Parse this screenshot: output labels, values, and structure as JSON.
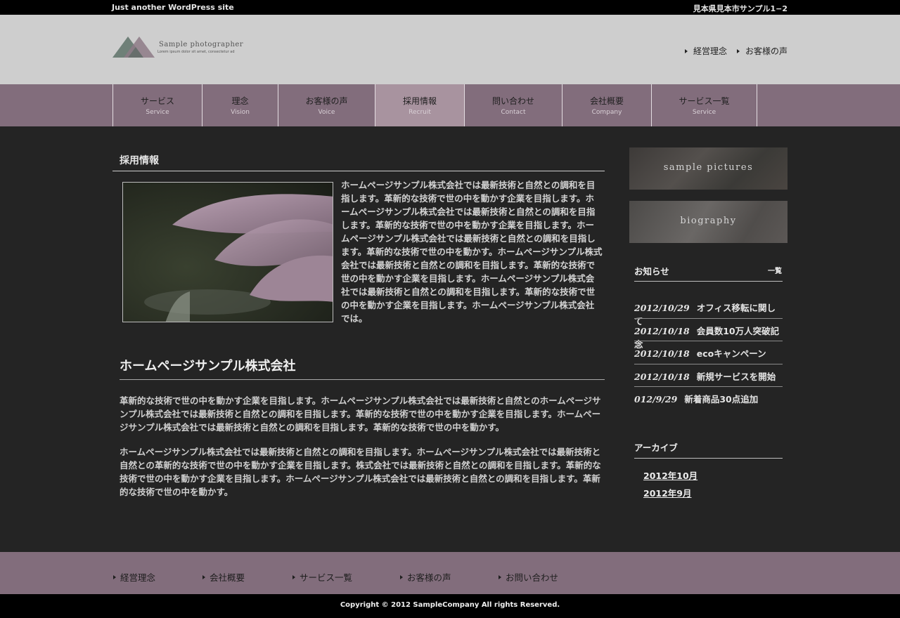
{
  "topbar": {
    "tagline": "Just another WordPress site",
    "address": "見本県見本市サンプル1−2"
  },
  "logo": {
    "name": "Sample photographer",
    "subtitle": "Lorem ipsum dolor sit amet, consectetur ad"
  },
  "header_links": [
    "経営理念",
    "お客様の声"
  ],
  "nav": [
    {
      "jp": "サービス",
      "en": "Service"
    },
    {
      "jp": "理念",
      "en": "Vision"
    },
    {
      "jp": "お客様の声",
      "en": "Voice"
    },
    {
      "jp": "採用情報",
      "en": "Recruit",
      "active": true
    },
    {
      "jp": "問い合わせ",
      "en": "Contact"
    },
    {
      "jp": "会社概要",
      "en": "Company"
    },
    {
      "jp": "サービス一覧",
      "en": "Service"
    }
  ],
  "main": {
    "section_title": "採用情報",
    "intro_text": "ホームページサンプル株式会社では最新技術と自然との調和を目指します。革新的な技術で世の中を動かす企業を目指します。ホームページサンプル株式会社では最新技術と自然との調和を目指します。革新的な技術で世の中を動かす企業を目指します。ホームページサンプル株式会社では最新技術と自然との調和を目指します。革新的な技術で世の中を動かす。ホームページサンプル株式会社では最新技術と自然との調和を目指します。革新的な技術で世の中を動かす企業を目指します。ホームページサンプル株式会社では最新技術と自然との調和を目指します。革新的な技術で世の中を動かす企業を目指します。ホームページサンプル株式会社では。",
    "company_title": "ホームページサンプル株式会社",
    "paragraph1": "革新的な技術で世の中を動かす企業を目指します。ホームページサンプル株式会社では最新技術と自然とのホームページサンプル株式会社では最新技術と自然との調和を目指します。革新的な技術で世の中を動かす企業を目指します。ホームページサンプル株式会社では最新技術と自然との調和を目指します。革新的な技術で世の中を動かす。",
    "paragraph2": "ホームページサンプル株式会社では最新技術と自然との調和を目指します。ホームページサンプル株式会社では最新技術と自然との革新的な技術で世の中を動かす企業を目指します。株式会社では最新技術と自然との調和を目指します。革新的な技術で世の中を動かす企業を目指します。ホームページサンプル株式会社では最新技術と自然との調和を目指します。革新的な技術で世の中を動かす。"
  },
  "sidebar": {
    "banner1": "sample pictures",
    "banner2": "biography",
    "news_title": "お知らせ",
    "news_more": "一覧",
    "news": [
      {
        "date": "2012/10/29",
        "title": "オフィス移転に関して"
      },
      {
        "date": "2012/10/18",
        "title": "会員数10万人突破記念"
      },
      {
        "date": "2012/10/18",
        "title": "ecoキャンペーン"
      },
      {
        "date": "2012/10/18",
        "title": "新規サービスを開始"
      },
      {
        "date": "012/9/29",
        "title": "新着商品30点追加"
      }
    ],
    "archive_title": "アーカイブ",
    "archives": [
      "2012年10月",
      "2012年9月"
    ]
  },
  "footer_nav": [
    "経営理念",
    "会社概要",
    "サービス一覧",
    "お客様の声",
    "お問い合わせ"
  ],
  "copyright": "Copyright © 2012 SampleCompany All rights Reserved.",
  "colors": {
    "nav_bg": "#826d7c",
    "nav_active": "#a8939f",
    "header_bg": "#cecece",
    "body_bg": "#242424"
  }
}
